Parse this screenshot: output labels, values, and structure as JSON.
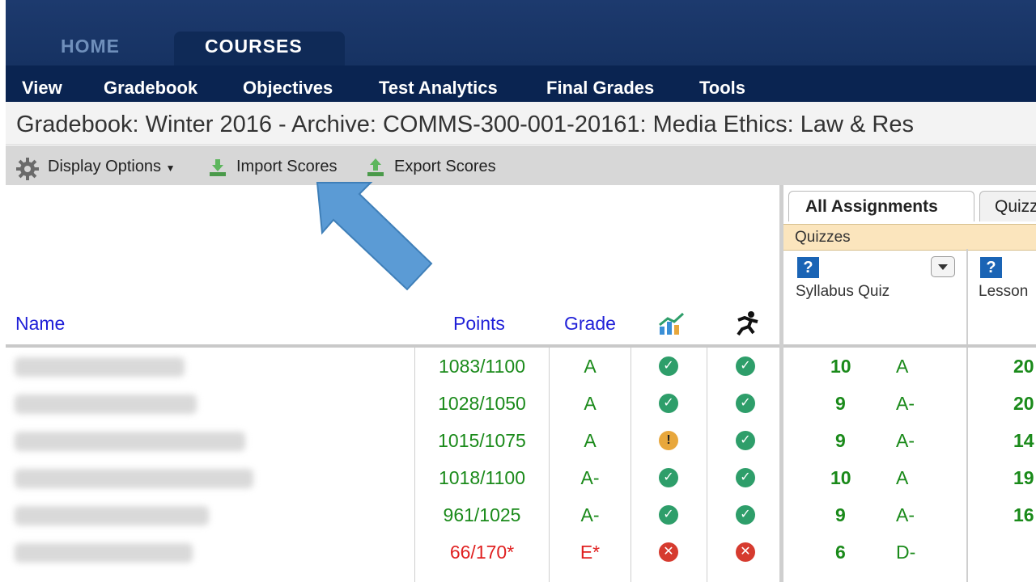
{
  "nav": {
    "tabs": [
      {
        "label": "HOME",
        "active": false
      },
      {
        "label": "COURSES",
        "active": true
      }
    ]
  },
  "menu": {
    "items": [
      "View",
      "Gradebook",
      "Objectives",
      "Test Analytics",
      "Final Grades",
      "Tools"
    ]
  },
  "page": {
    "title": "Gradebook: Winter 2016 - Archive: COMMS-300-001-20161: Media Ethics: Law & Res"
  },
  "toolbar": {
    "display_options": "Display Options",
    "import_scores": "Import Scores",
    "export_scores": "Export Scores"
  },
  "grid": {
    "columns": {
      "name": "Name",
      "points": "Points",
      "grade": "Grade"
    },
    "rows": [
      {
        "points": "1083/1100",
        "grade": "A",
        "trend": "ok",
        "activity": "ok",
        "quiz_score": "10",
        "quiz_grade": "A",
        "next_score": "20",
        "status": "green"
      },
      {
        "points": "1028/1050",
        "grade": "A",
        "trend": "ok",
        "activity": "ok",
        "quiz_score": "9",
        "quiz_grade": "A-",
        "next_score": "20",
        "status": "green"
      },
      {
        "points": "1015/1075",
        "grade": "A",
        "trend": "warn",
        "activity": "ok",
        "quiz_score": "9",
        "quiz_grade": "A-",
        "next_score": "14",
        "status": "green"
      },
      {
        "points": "1018/1100",
        "grade": "A-",
        "trend": "ok",
        "activity": "ok",
        "quiz_score": "10",
        "quiz_grade": "A",
        "next_score": "19",
        "status": "green"
      },
      {
        "points": "961/1025",
        "grade": "A-",
        "trend": "ok",
        "activity": "ok",
        "quiz_score": "9",
        "quiz_grade": "A-",
        "next_score": "16",
        "status": "green"
      },
      {
        "points": "66/170*",
        "grade": "E*",
        "trend": "bad",
        "activity": "bad",
        "quiz_score": "6",
        "quiz_grade": "D-",
        "next_score": "",
        "status": "red"
      }
    ]
  },
  "assignments": {
    "tabs": [
      "All Assignments",
      "Quizz"
    ],
    "category": "Quizzes",
    "help_icon_glyph": "?",
    "columns": [
      "Syllabus Quiz",
      "Lesson"
    ]
  },
  "colors": {
    "nav_bg": "#163262",
    "menu_bg": "#0a2451",
    "link_blue": "#2020d8",
    "pass_green": "#1a8a1a",
    "fail_red": "#e02020",
    "arrow_blue": "#5b9bd5"
  }
}
